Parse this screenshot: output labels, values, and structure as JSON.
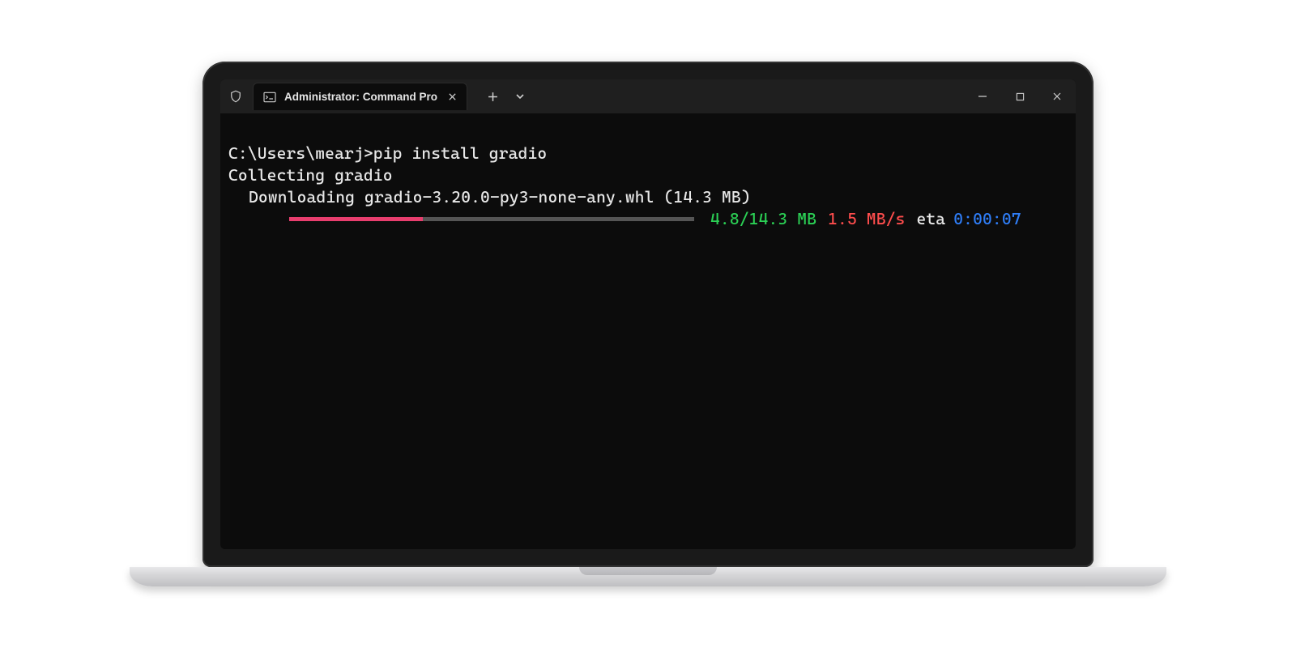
{
  "window": {
    "tab_title": "Administrator: Command Pro"
  },
  "terminal": {
    "prompt": "C:\\Users\\mearj>",
    "command": "pip install gradio",
    "line_collecting": "Collecting gradio",
    "line_downloading": "Downloading gradio-3.20.0-py3-none-any.whl (14.3 MB)",
    "progress": {
      "done_mb": 4.8,
      "total_mb": 14.3,
      "percent": 33,
      "size_text": "4.8/14.3 MB",
      "speed_text": "1.5 MB/s",
      "eta_label": "eta",
      "eta_text": "0:00:07"
    }
  },
  "colors": {
    "progress_fill": "#e83e6e",
    "size": "#2bd155",
    "speed": "#ff4d4d",
    "eta": "#2f7df6"
  }
}
